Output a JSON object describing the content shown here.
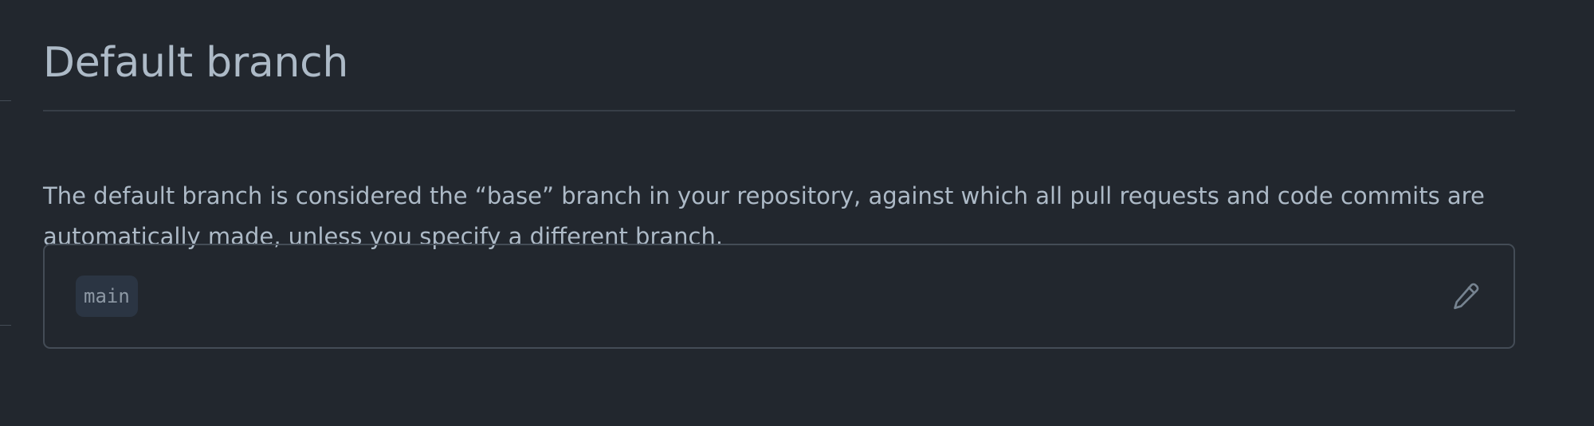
{
  "section": {
    "title": "Default branch",
    "description": "The default branch is considered the “base” branch in your repository, against which all pull requests and code commits are automatically made, unless you specify a different branch."
  },
  "default_branch": {
    "name": "main",
    "edit_icon": "pencil-icon"
  },
  "colors": {
    "background": "#22272e",
    "text": "#adbac7",
    "border": "#444c56",
    "branch_pill_bg": "#2b3543",
    "branch_pill_text": "#8d98a4",
    "icon": "#768390"
  }
}
